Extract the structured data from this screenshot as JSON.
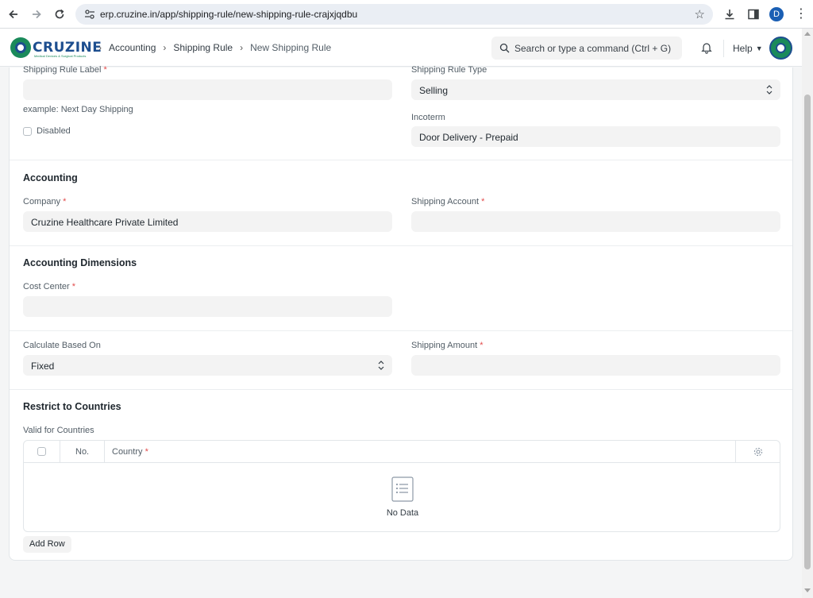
{
  "browser": {
    "url": "erp.cruzine.in/app/shipping-rule/new-shipping-rule-crajxjqdbu",
    "profile_initial": "D"
  },
  "navbar": {
    "logo_text": "CRUZINE",
    "logo_tagline": "Medical Devices & Surgical Products",
    "breadcrumbs": [
      "Accounting",
      "Shipping Rule",
      "New Shipping Rule"
    ],
    "search_placeholder": "Search or type a command (Ctrl + G)",
    "help_label": "Help"
  },
  "form": {
    "shipping_rule_label": {
      "label": "Shipping Rule Label",
      "value": "",
      "hint": "example: Next Day Shipping"
    },
    "disabled_label": "Disabled",
    "shipping_rule_type": {
      "label": "Shipping Rule Type",
      "value": "Selling"
    },
    "incoterm": {
      "label": "Incoterm",
      "value": "Door Delivery - Prepaid"
    },
    "accounting": {
      "title": "Accounting",
      "company": {
        "label": "Company",
        "value": "Cruzine Healthcare Private Limited"
      },
      "shipping_account": {
        "label": "Shipping Account",
        "value": ""
      }
    },
    "dimensions": {
      "title": "Accounting Dimensions",
      "cost_center": {
        "label": "Cost Center",
        "value": ""
      }
    },
    "calculation": {
      "calculate_based_on": {
        "label": "Calculate Based On",
        "value": "Fixed"
      },
      "shipping_amount": {
        "label": "Shipping Amount",
        "value": ""
      }
    },
    "countries": {
      "title": "Restrict to Countries",
      "table_label": "Valid for Countries",
      "col_no": "No.",
      "col_country": "Country",
      "empty_text": "No Data",
      "add_row_label": "Add Row"
    }
  },
  "colors": {
    "required": "#e24c4c",
    "brand_blue": "#1d4e8f",
    "brand_green": "#1a8a5a",
    "field_bg": "#f3f3f3"
  }
}
